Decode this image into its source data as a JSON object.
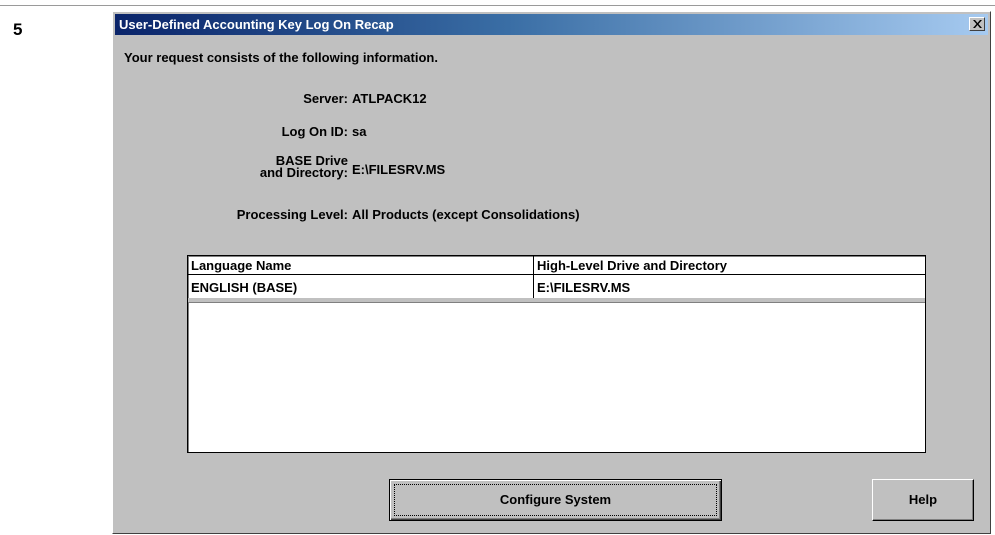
{
  "step_number": "5",
  "window": {
    "title": "User-Defined Accounting Key Log On Recap",
    "close_glyph": "×"
  },
  "intro_text": "Your request consists of the following information.",
  "fields": {
    "server_label": "Server:",
    "server_value": "ATLPACK12",
    "logon_label": "Log On ID:",
    "logon_value": "sa",
    "base_label_line1": "BASE Drive",
    "base_label_line2": "and Directory:",
    "base_value": "E:\\FILESRV.MS",
    "processing_label": "Processing Level:",
    "processing_value": "All Products (except Consolidations)"
  },
  "table": {
    "columns": [
      "Language Name",
      "High-Level Drive and Directory"
    ],
    "rows": [
      [
        "ENGLISH  (BASE)",
        "E:\\FILESRV.MS"
      ]
    ]
  },
  "buttons": {
    "configure_label": "Configure System",
    "help_label": "Help"
  }
}
